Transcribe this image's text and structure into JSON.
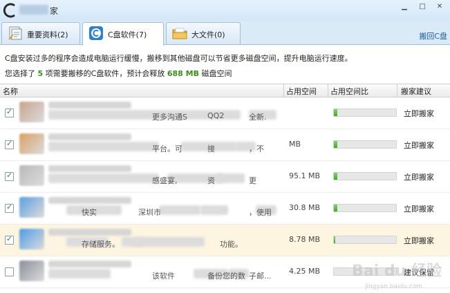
{
  "window": {
    "title_suffix": "家",
    "controls": [
      "▁",
      "□",
      "✕"
    ]
  },
  "tabs": [
    {
      "label": "重要资料(2)",
      "icon": "document-stack-icon",
      "active": false
    },
    {
      "label": "C盘软件(7)",
      "icon": "c-drive-icon",
      "active": true
    },
    {
      "label": "大文件(0)",
      "icon": "folder-icon",
      "active": false
    }
  ],
  "back_link": "搬回C盘",
  "info": {
    "line1": "C盘安装过多的程序会造成电脑运行缓慢，搬移到其他磁盘可以节省更多磁盘空间，提升电脑运行速度。",
    "selected_prefix": "您选择了",
    "selected_count": "5",
    "selected_mid": "项需要搬移的C盘软件，预计会释放",
    "freed_size": "688 MB",
    "selected_suffix": "磁盘空间"
  },
  "table": {
    "headers": [
      "名称",
      "占用空间",
      "占用空间比",
      "搬家建议"
    ],
    "rows": [
      {
        "checked": true,
        "desc": "更多沟通S",
        "desc2": "QQ2",
        "desc3": "全新.",
        "size": "",
        "ratio": 0.05,
        "action": "立即搬家",
        "thumb": "#c9a48e"
      },
      {
        "checked": true,
        "desc": "平台。可",
        "desc2": "接",
        "desc3": "，不",
        "size": "MB",
        "ratio": 0.06,
        "action": "立即搬家",
        "thumb": "#d9a064"
      },
      {
        "checked": true,
        "desc": "感盛宴,",
        "desc2": "资",
        "desc3": "更",
        "size": "95.1 MB",
        "ratio": 0.06,
        "action": "立即搬家",
        "thumb": "#b9b9b9"
      },
      {
        "checked": true,
        "desc": "快实",
        "desc2": "深圳市",
        "desc3": "，使用",
        "size": "30.8 MB",
        "ratio": 0.05,
        "action": "立即搬家",
        "thumb": "#5e9ee0"
      },
      {
        "checked": true,
        "desc": "存储服务。",
        "desc2": "",
        "desc3": "功能。",
        "size": "8.78 MB",
        "ratio": 0.02,
        "action": "立即搬家",
        "thumb": "#4d9be6"
      },
      {
        "checked": false,
        "desc": "该软件",
        "desc2": "备份您的数",
        "desc3": "子邮...",
        "size": "4.25 MB",
        "ratio": 0.0,
        "action": "建议保留",
        "thumb": "#8a8f99"
      }
    ]
  },
  "watermark": {
    "main": "Bai du 经验",
    "sub": "jingyan.baidu.com"
  }
}
